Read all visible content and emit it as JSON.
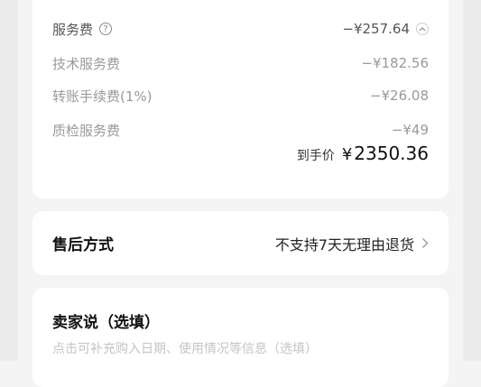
{
  "fees": {
    "service": {
      "label": "服务费",
      "amount": "−¥257.64"
    },
    "tech": {
      "label": "技术服务费",
      "amount": "−¥182.56"
    },
    "transfer": {
      "label": "转账手续费(1%)",
      "amount": "−¥26.08"
    },
    "inspection": {
      "label": "质检服务费",
      "amount": "−¥49"
    },
    "net": {
      "label": "到手价",
      "currency": "¥",
      "amount": "2350.36"
    }
  },
  "after_sale": {
    "title": "售后方式",
    "value": "不支持7天无理由退货"
  },
  "seller_note": {
    "title": "卖家说（选填）",
    "placeholder": "点击可补充购入日期、使用情况等信息（选填）"
  }
}
